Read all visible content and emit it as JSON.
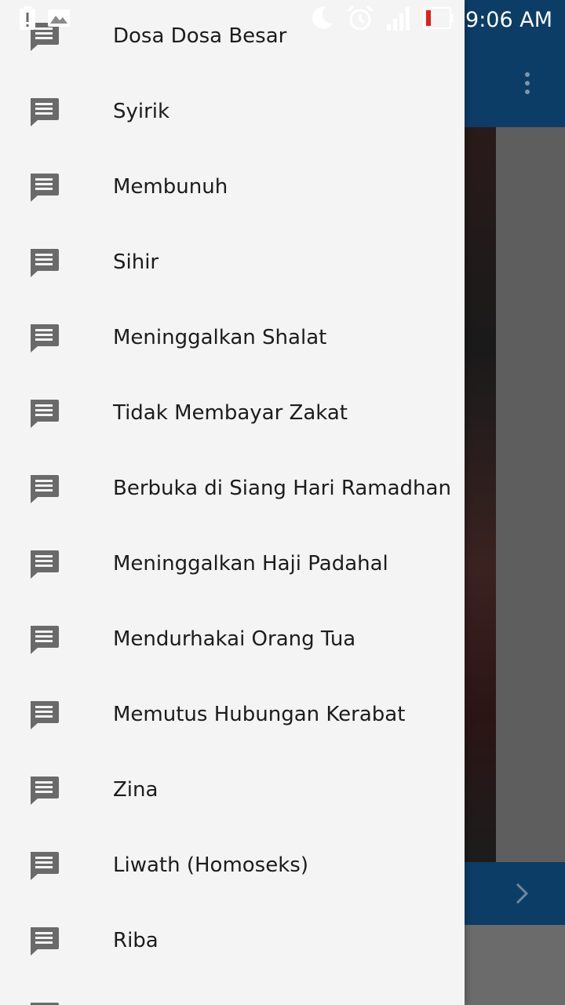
{
  "status_bar": {
    "time": "9:06 AM",
    "left_icons": [
      "battery-alert-icon",
      "image-icon"
    ],
    "right_icons": [
      "moon-icon",
      "alarm-icon",
      "signal-icon",
      "battery-low-icon"
    ]
  },
  "drawer": {
    "items": [
      {
        "label": "Dosa Dosa Besar",
        "icon": "message-icon"
      },
      {
        "label": "Syirik",
        "icon": "message-icon"
      },
      {
        "label": "Membunuh",
        "icon": "message-icon"
      },
      {
        "label": "Sihir",
        "icon": "message-icon"
      },
      {
        "label": "Meninggalkan Shalat",
        "icon": "message-icon"
      },
      {
        "label": "Tidak Membayar Zakat",
        "icon": "message-icon"
      },
      {
        "label": "Berbuka di Siang Hari Ramadhan",
        "icon": "message-icon"
      },
      {
        "label": "Meninggalkan Haji Padahal",
        "icon": "message-icon"
      },
      {
        "label": "Mendurhakai Orang Tua",
        "icon": "message-icon"
      },
      {
        "label": "Memutus Hubungan Kerabat",
        "icon": "message-icon"
      },
      {
        "label": "Zina",
        "icon": "message-icon"
      },
      {
        "label": "Liwath (Homoseks)",
        "icon": "message-icon"
      },
      {
        "label": "Riba",
        "icon": "message-icon"
      },
      {
        "label": "",
        "icon": "message-icon"
      }
    ]
  },
  "colors": {
    "appbar": "#0b3d66",
    "drawer_bg": "#f4f4f4",
    "icon": "#6a6a6a",
    "text": "#1c1c1c"
  }
}
